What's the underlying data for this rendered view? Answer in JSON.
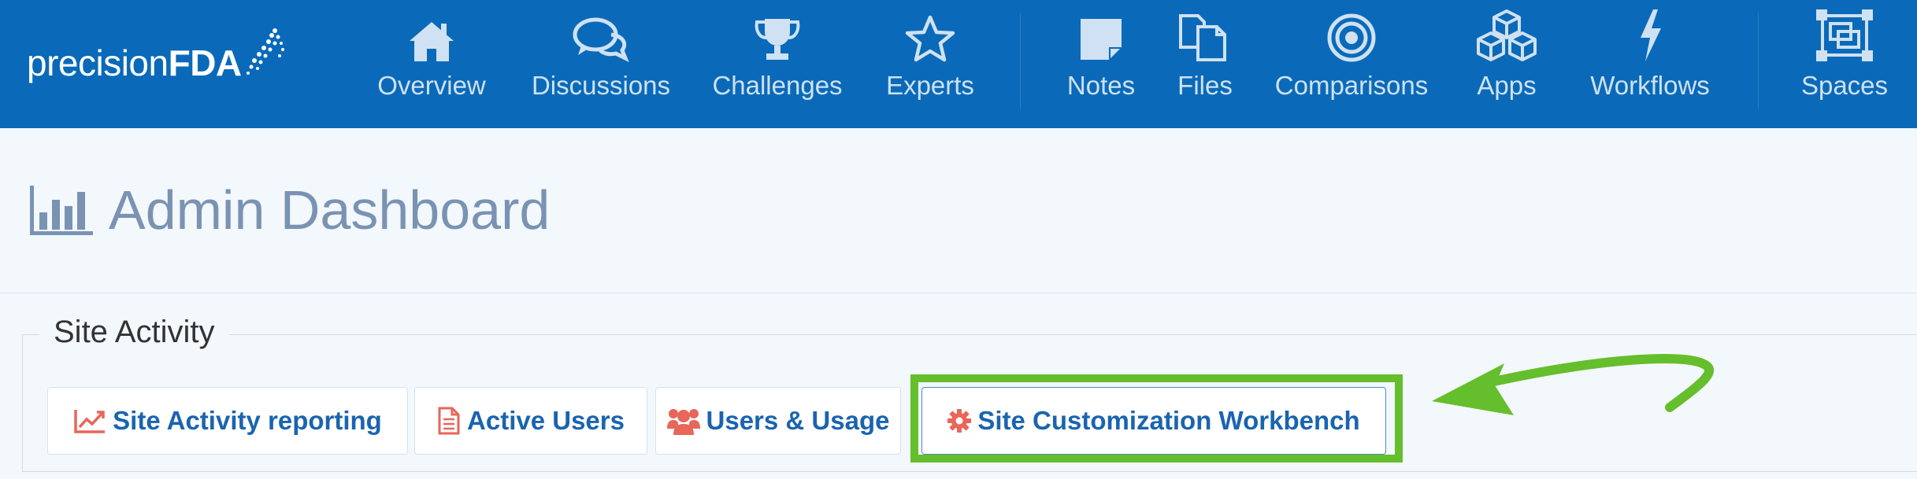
{
  "brand": {
    "light": "precision",
    "bold": "FDA"
  },
  "nav": {
    "items": [
      {
        "label": "Overview",
        "icon": "home-icon"
      },
      {
        "label": "Discussions",
        "icon": "comments-icon"
      },
      {
        "label": "Challenges",
        "icon": "trophy-icon"
      },
      {
        "label": "Experts",
        "icon": "star-icon"
      },
      {
        "label": "Notes",
        "icon": "note-icon"
      },
      {
        "label": "Files",
        "icon": "files-icon"
      },
      {
        "label": "Comparisons",
        "icon": "target-icon"
      },
      {
        "label": "Apps",
        "icon": "cubes-icon"
      },
      {
        "label": "Workflows",
        "icon": "bolt-icon"
      },
      {
        "label": "Spaces",
        "icon": "spaces-icon"
      }
    ]
  },
  "page": {
    "title": "Admin Dashboard"
  },
  "section": {
    "legend": "Site Activity",
    "tabs": [
      {
        "label": "Site Activity reporting",
        "icon": "line-chart-icon"
      },
      {
        "label": "Active Users",
        "icon": "document-icon"
      },
      {
        "label": "Users & Usage",
        "icon": "users-icon"
      },
      {
        "label": "Site Customization Workbench",
        "icon": "gear-icon"
      }
    ]
  },
  "colors": {
    "navbar": "#0a6ab9",
    "nav_text": "#cfe1f2",
    "title_text": "#7a93b3",
    "tab_text": "#1a64b0",
    "tab_icon": "#e8665a",
    "highlight": "#65be2c"
  }
}
